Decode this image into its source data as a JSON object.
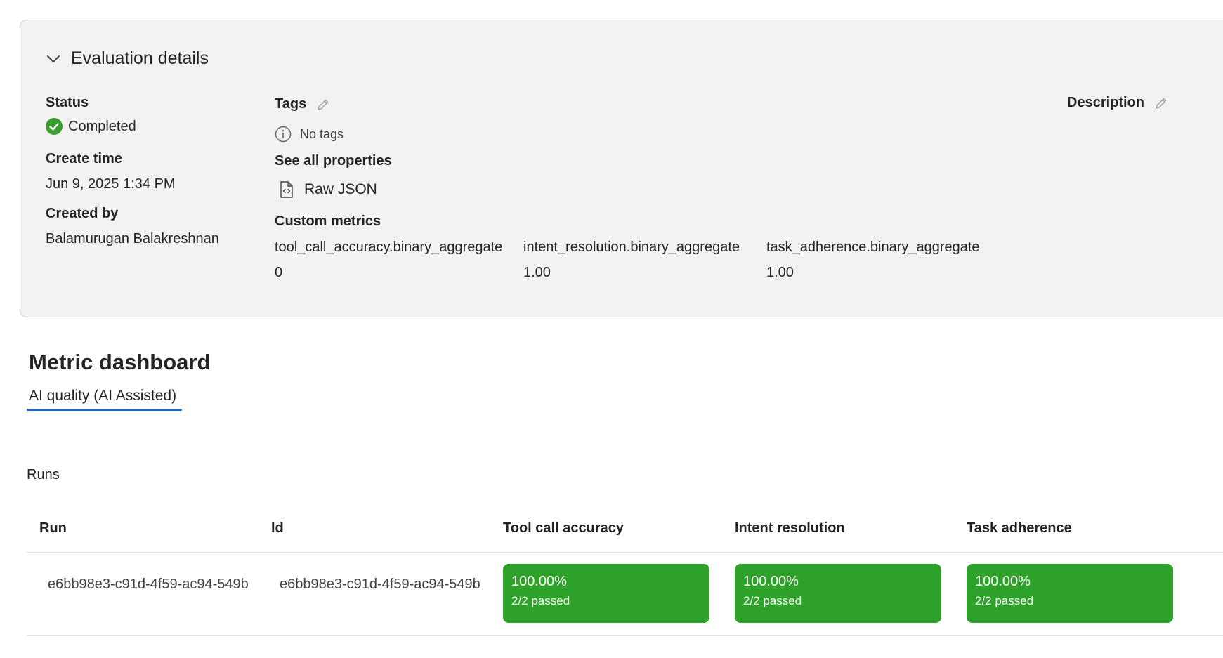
{
  "details": {
    "title": "Evaluation details",
    "status_label": "Status",
    "status_value": "Completed",
    "create_time_label": "Create time",
    "create_time_value": "Jun 9, 2025 1:34 PM",
    "created_by_label": "Created by",
    "created_by_value": "Balamurugan Balakreshnan",
    "tags_label": "Tags",
    "no_tags": "No tags",
    "see_all_properties": "See all properties",
    "raw_json": "Raw JSON",
    "description_label": "Description",
    "custom_metrics_label": "Custom metrics",
    "custom_metrics": [
      {
        "name": "tool_call_accuracy.binary_aggregate",
        "value": "0"
      },
      {
        "name": "intent_resolution.binary_aggregate",
        "value": "1.00"
      },
      {
        "name": "task_adherence.binary_aggregate",
        "value": "1.00"
      }
    ]
  },
  "dashboard": {
    "title": "Metric dashboard",
    "tabs": [
      {
        "label": "AI quality (AI Assisted)",
        "selected": true
      }
    ],
    "runs_label": "Runs",
    "columns": [
      "Run",
      "Id",
      "Tool call accuracy",
      "Intent resolution",
      "Task adherence"
    ],
    "rows": [
      {
        "run": "e6bb98e3-c91d-4f59-ac94-549b",
        "id": "e6bb98e3-c91d-4f59-ac94-549b",
        "scores": [
          {
            "percent": "100.00%",
            "passed": "2/2 passed"
          },
          {
            "percent": "100.00%",
            "passed": "2/2 passed"
          },
          {
            "percent": "100.00%",
            "passed": "2/2 passed"
          }
        ]
      }
    ]
  },
  "colors": {
    "card_bg": "#f3f2f1",
    "success_green": "#2ea12a",
    "tab_underline": "#2266c9",
    "status_check": "#3b9c2f"
  },
  "icons": [
    "chevron-down-icon",
    "check-circle-icon",
    "edit-pencil-icon",
    "info-icon",
    "code-file-icon"
  ]
}
